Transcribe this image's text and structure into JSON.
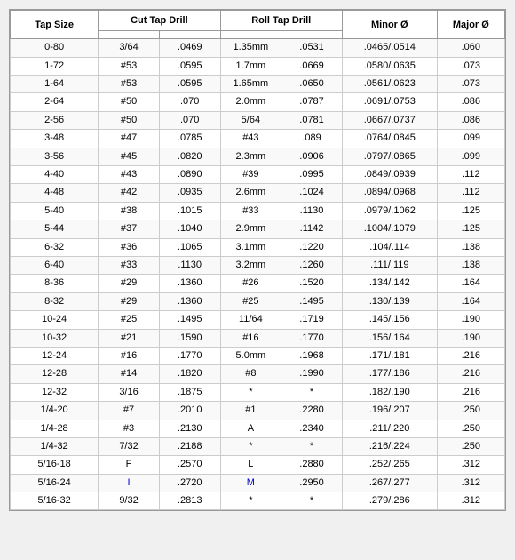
{
  "table": {
    "headers": [
      "Tap Size",
      "Cut Tap Drill",
      "",
      "Roll Tap Drill",
      "",
      "Minor Ø",
      "Major Ø"
    ],
    "rows": [
      [
        "0-80",
        "3/64",
        ".0469",
        "1.35mm",
        ".0531",
        ".0465/.0514",
        ".060"
      ],
      [
        "1-72",
        "#53",
        ".0595",
        "1.7mm",
        ".0669",
        ".0580/.0635",
        ".073"
      ],
      [
        "1-64",
        "#53",
        ".0595",
        "1.65mm",
        ".0650",
        ".0561/.0623",
        ".073"
      ],
      [
        "2-64",
        "#50",
        ".070",
        "2.0mm",
        ".0787",
        ".0691/.0753",
        ".086"
      ],
      [
        "2-56",
        "#50",
        ".070",
        "5/64",
        ".0781",
        ".0667/.0737",
        ".086"
      ],
      [
        "3-48",
        "#47",
        ".0785",
        "#43",
        ".089",
        ".0764/.0845",
        ".099"
      ],
      [
        "3-56",
        "#45",
        ".0820",
        "2.3mm",
        ".0906",
        ".0797/.0865",
        ".099"
      ],
      [
        "4-40",
        "#43",
        ".0890",
        "#39",
        ".0995",
        ".0849/.0939",
        ".112"
      ],
      [
        "4-48",
        "#42",
        ".0935",
        "2.6mm",
        ".1024",
        ".0894/.0968",
        ".112"
      ],
      [
        "5-40",
        "#38",
        ".1015",
        "#33",
        ".1130",
        ".0979/.1062",
        ".125"
      ],
      [
        "5-44",
        "#37",
        ".1040",
        "2.9mm",
        ".1142",
        ".1004/.1079",
        ".125"
      ],
      [
        "6-32",
        "#36",
        ".1065",
        "3.1mm",
        ".1220",
        ".104/.114",
        ".138"
      ],
      [
        "6-40",
        "#33",
        ".1130",
        "3.2mm",
        ".1260",
        ".111/.119",
        ".138"
      ],
      [
        "8-36",
        "#29",
        ".1360",
        "#26",
        ".1520",
        ".134/.142",
        ".164"
      ],
      [
        "8-32",
        "#29",
        ".1360",
        "#25",
        ".1495",
        ".130/.139",
        ".164"
      ],
      [
        "10-24",
        "#25",
        ".1495",
        "11/64",
        ".1719",
        ".145/.156",
        ".190"
      ],
      [
        "10-32",
        "#21",
        ".1590",
        "#16",
        ".1770",
        ".156/.164",
        ".190"
      ],
      [
        "12-24",
        "#16",
        ".1770",
        "5.0mm",
        ".1968",
        ".171/.181",
        ".216"
      ],
      [
        "12-28",
        "#14",
        ".1820",
        "#8",
        ".1990",
        ".177/.186",
        ".216"
      ],
      [
        "12-32",
        "3/16",
        ".1875",
        "*",
        "*",
        ".182/.190",
        ".216"
      ],
      [
        "1/4-20",
        "#7",
        ".2010",
        "#1",
        ".2280",
        ".196/.207",
        ".250"
      ],
      [
        "1/4-28",
        "#3",
        ".2130",
        "A",
        ".2340",
        ".211/.220",
        ".250"
      ],
      [
        "1/4-32",
        "7/32",
        ".2188",
        "*",
        "*",
        ".216/.224",
        ".250"
      ],
      [
        "5/16-18",
        "F",
        ".2570",
        "L",
        ".2880",
        ".252/.265",
        ".312"
      ],
      [
        "5/16-24",
        "I",
        ".2720",
        "M",
        ".2950",
        ".267/.277",
        ".312"
      ],
      [
        "5/16-32",
        "9/32",
        ".2813",
        "*",
        "*",
        ".279/.286",
        ".312"
      ]
    ],
    "blue_rows": [
      24
    ]
  }
}
